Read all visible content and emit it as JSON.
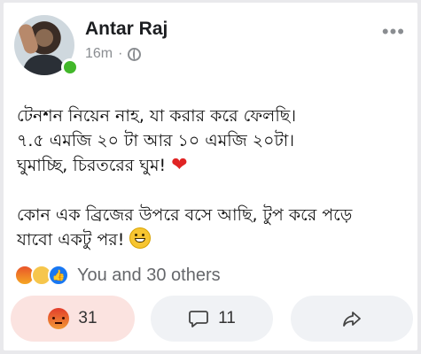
{
  "post": {
    "author": "Antar Raj",
    "time": "16m",
    "separator": "·",
    "lines": [
      "টেনশন নিয়েন নাহ, যা করার করে ফেলছি।",
      "৭.৫ এমজি ২০ টা আর ১০ এমজি ২০টা।",
      "ঘুমাচ্ছি, চিরতরের ঘুম!",
      "কোন এক ব্রিজের উপরে বসে আছি, টুপ করে পড়ে",
      "যাবো একটু পর!"
    ],
    "heart_emoji": "❤",
    "more_menu": "•••"
  },
  "reactions": {
    "summary": "You and 30 others",
    "icons": [
      "angry-emoji",
      "sad-emoji",
      "like-emoji"
    ]
  },
  "actions": {
    "react_count": "31",
    "comment_count": "11"
  },
  "colors": {
    "online": "#42b72a",
    "react_button_bg": "#fbe3e0",
    "button_bg": "#f0f2f5",
    "like": "#1877f2"
  }
}
